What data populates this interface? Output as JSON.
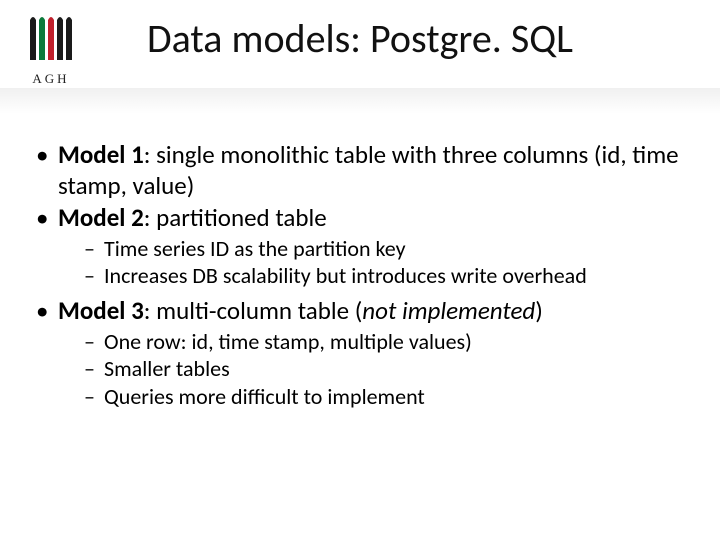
{
  "logo": {
    "text": "AGH"
  },
  "title": "Data models: Postgre. SQL",
  "bullets": [
    {
      "label": "Model 1",
      "text": ": single monolithic table with three columns (id, time stamp, value)"
    },
    {
      "label": "Model 2",
      "text": ": partitioned table",
      "sub": [
        "Time series ID as the partition key",
        "Increases DB scalability but introduces write overhead"
      ]
    },
    {
      "label": "Model 3",
      "text": ": multi-column table (",
      "italic": "not implemented",
      "tail": ")",
      "sub": [
        "One row: id, time stamp, multiple values)",
        "Smaller tables",
        "Queries more difficult to implement"
      ]
    }
  ]
}
